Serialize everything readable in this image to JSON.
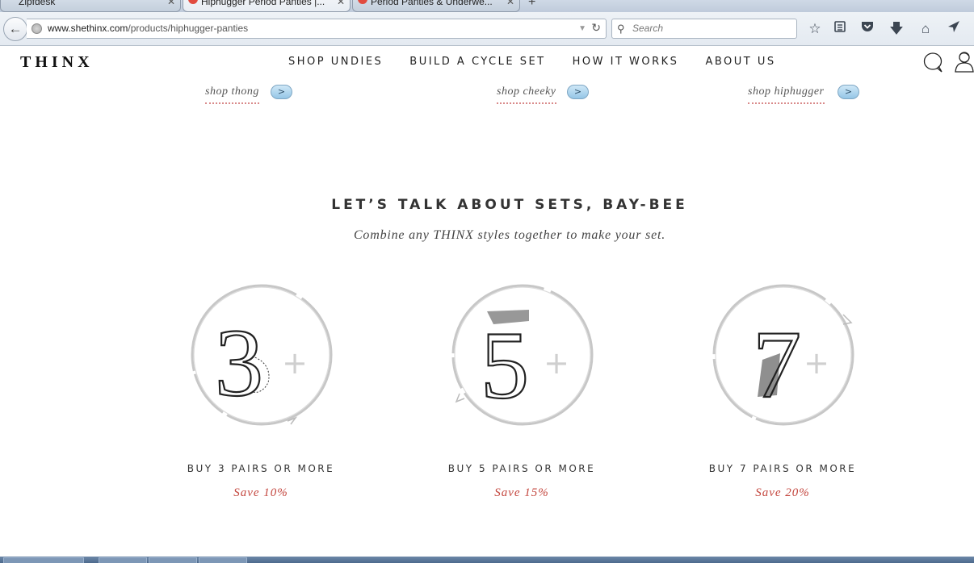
{
  "browser": {
    "tabs": [
      {
        "title": "Zipfdesk",
        "active": false
      },
      {
        "title": "Hiphugger Period Panties |...",
        "active": true
      },
      {
        "title": "Period Panties & Underwe...",
        "active": false
      }
    ],
    "new_tab": "+",
    "url_host": "www.shethinx.com",
    "url_path": "/products/hiphugger-panties",
    "search_placeholder": "Search",
    "toolbar_icons": [
      "bookmark-star-icon",
      "reading-list-icon",
      "pocket-icon",
      "downloads-icon",
      "home-icon",
      "send-icon"
    ]
  },
  "site": {
    "logo": "THINX",
    "nav": [
      "SHOP UNDIES",
      "BUILD A CYCLE SET",
      "HOW IT WORKS",
      "ABOUT US"
    ]
  },
  "shop_links": [
    {
      "label": "shop thong",
      "arrow": ">"
    },
    {
      "label": "shop cheeky",
      "arrow": ">"
    },
    {
      "label": "shop hiphugger",
      "arrow": ">"
    }
  ],
  "sets": {
    "title": "LET’S TALK ABOUT SETS, BAY-BEE",
    "subtitle": "Combine any THINX styles together to make your set.",
    "offers": [
      {
        "number": "3",
        "plus": "+",
        "label": "BUY 3 PAIRS OR MORE",
        "save": "Save 10%"
      },
      {
        "number": "5",
        "plus": "+",
        "label": "BUY 5 PAIRS OR MORE",
        "save": "Save 15%"
      },
      {
        "number": "7",
        "plus": "+",
        "label": "BUY 7 PAIRS OR MORE",
        "save": "Save 20%"
      }
    ]
  },
  "colors": {
    "accent_red": "#c4473f",
    "pill_blue": "#95c6e6",
    "text_dark": "#222222"
  }
}
